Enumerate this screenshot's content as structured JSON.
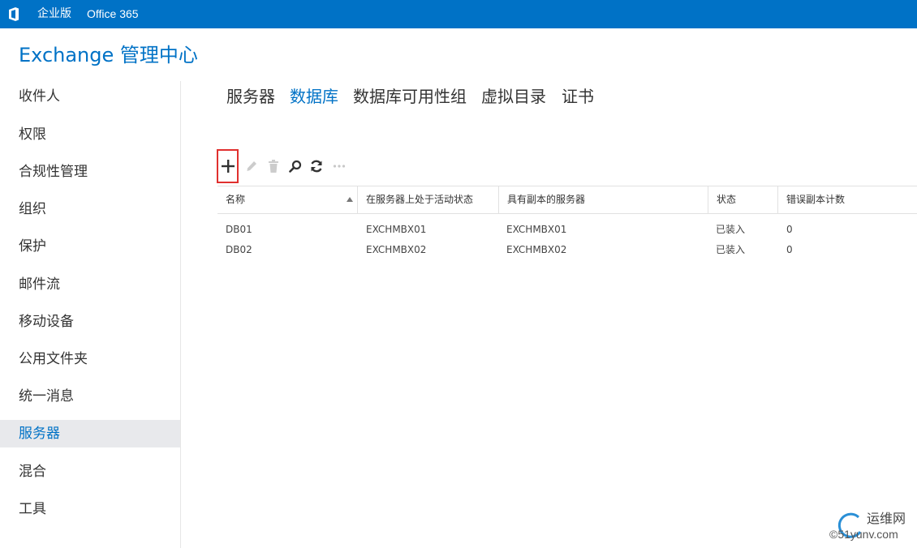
{
  "topbar": {
    "edition": "企业版",
    "product": "Office 365",
    "logo_icon": "office-logo-icon"
  },
  "app": {
    "title": "Exchange 管理中心"
  },
  "sidebar": {
    "items": [
      {
        "label": "收件人"
      },
      {
        "label": "权限"
      },
      {
        "label": "合规性管理"
      },
      {
        "label": "组织"
      },
      {
        "label": "保护"
      },
      {
        "label": "邮件流"
      },
      {
        "label": "移动设备"
      },
      {
        "label": "公用文件夹"
      },
      {
        "label": "统一消息"
      },
      {
        "label": "服务器",
        "selected": true
      },
      {
        "label": "混合"
      },
      {
        "label": "工具"
      }
    ]
  },
  "tabs": [
    {
      "label": "服务器"
    },
    {
      "label": "数据库",
      "active": true
    },
    {
      "label": "数据库可用性组"
    },
    {
      "label": "虚拟目录"
    },
    {
      "label": "证书"
    }
  ],
  "toolbar": {
    "icons": [
      "add-icon",
      "edit-icon",
      "delete-icon",
      "search-icon",
      "refresh-icon",
      "more-icon"
    ]
  },
  "table": {
    "columns": [
      "名称",
      "在服务器上处于活动状态",
      "具有副本的服务器",
      "状态",
      "错误副本计数"
    ],
    "sort_column": "名称",
    "rows": [
      [
        "DB01",
        "EXCHMBX01",
        "EXCHMBX01",
        "已装入",
        "0"
      ],
      [
        "DB02",
        "EXCHMBX02",
        "EXCHMBX02",
        "已装入",
        "0"
      ]
    ]
  },
  "watermark": {
    "line1": "运维网",
    "line2": "©51yunv.com"
  },
  "colors": {
    "brand": "#0072c6",
    "highlight": "#e0302e",
    "selected_bg": "#e8e9ec"
  }
}
